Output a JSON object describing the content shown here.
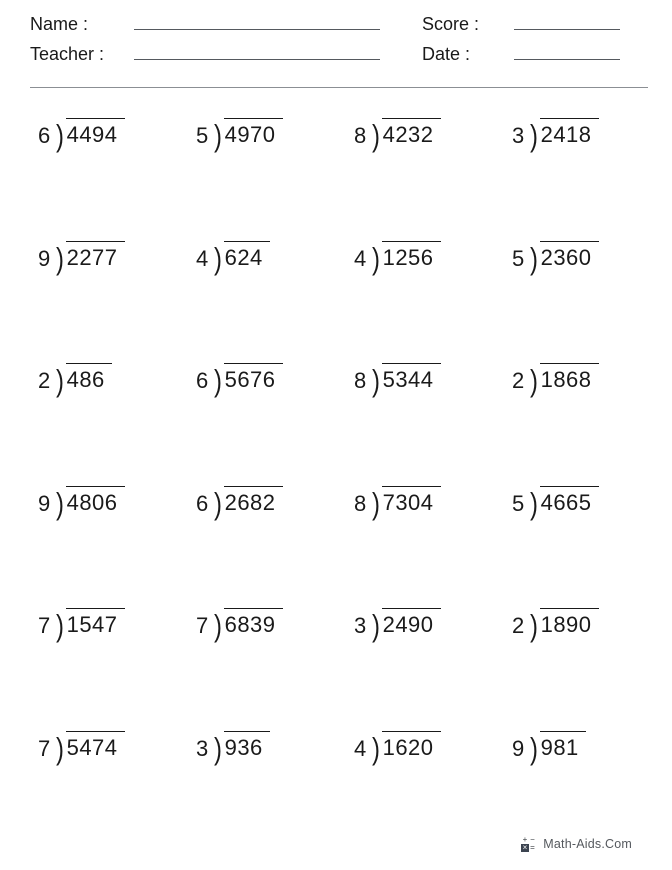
{
  "header": {
    "name_label": "Name :",
    "teacher_label": "Teacher :",
    "score_label": "Score :",
    "date_label": "Date :",
    "name_value": "",
    "teacher_value": "",
    "score_value": "",
    "date_value": ""
  },
  "worksheet": {
    "operator_symbol": ")",
    "rows": [
      [
        {
          "divisor": "6",
          "dividend": "4494"
        },
        {
          "divisor": "5",
          "dividend": "4970"
        },
        {
          "divisor": "8",
          "dividend": "4232"
        },
        {
          "divisor": "3",
          "dividend": "2418"
        }
      ],
      [
        {
          "divisor": "9",
          "dividend": "2277"
        },
        {
          "divisor": "4",
          "dividend": "624"
        },
        {
          "divisor": "4",
          "dividend": "1256"
        },
        {
          "divisor": "5",
          "dividend": "2360"
        }
      ],
      [
        {
          "divisor": "2",
          "dividend": "486"
        },
        {
          "divisor": "6",
          "dividend": "5676"
        },
        {
          "divisor": "8",
          "dividend": "5344"
        },
        {
          "divisor": "2",
          "dividend": "1868"
        }
      ],
      [
        {
          "divisor": "9",
          "dividend": "4806"
        },
        {
          "divisor": "6",
          "dividend": "2682"
        },
        {
          "divisor": "8",
          "dividend": "7304"
        },
        {
          "divisor": "5",
          "dividend": "4665"
        }
      ],
      [
        {
          "divisor": "7",
          "dividend": "1547"
        },
        {
          "divisor": "7",
          "dividend": "6839"
        },
        {
          "divisor": "3",
          "dividend": "2490"
        },
        {
          "divisor": "2",
          "dividend": "1890"
        }
      ],
      [
        {
          "divisor": "7",
          "dividend": "5474"
        },
        {
          "divisor": "3",
          "dividend": "936"
        },
        {
          "divisor": "4",
          "dividend": "1620"
        },
        {
          "divisor": "9",
          "dividend": "981"
        }
      ]
    ]
  },
  "footer": {
    "text": "Math-Aids.Com",
    "logo_glyphs": [
      "+",
      "−",
      "×",
      "="
    ]
  },
  "colors": {
    "ink": "#1a1a1a",
    "rule": "#8b8f94",
    "footer_text": "#55595e",
    "logo_dark": "#3c4450"
  }
}
